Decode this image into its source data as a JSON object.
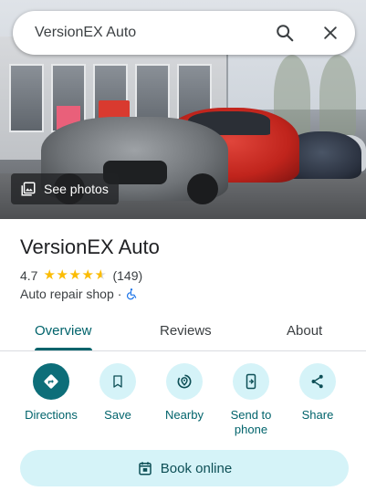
{
  "search": {
    "value": "VersionEX Auto",
    "search_icon": "search-icon",
    "close_icon": "close-icon"
  },
  "hero": {
    "see_photos_label": "See photos",
    "photos_icon": "photo-library-icon"
  },
  "place": {
    "name": "VersionEX Auto",
    "rating": "4.7",
    "stars": 4.7,
    "review_count": "(149)",
    "category": "Auto repair shop",
    "separator": "·",
    "accessibility_icon": "wheelchair-icon"
  },
  "tabs": [
    {
      "label": "Overview",
      "selected": true
    },
    {
      "label": "Reviews",
      "selected": false
    },
    {
      "label": "About",
      "selected": false
    }
  ],
  "actions": [
    {
      "label": "Directions",
      "icon": "directions-icon"
    },
    {
      "label": "Save",
      "icon": "bookmark-icon"
    },
    {
      "label": "Nearby",
      "icon": "nearby-icon"
    },
    {
      "label": "Send to phone",
      "icon": "send-to-phone-icon"
    },
    {
      "label": "Share",
      "icon": "share-icon"
    }
  ],
  "book": {
    "label": "Book online",
    "icon": "calendar-icon"
  },
  "colors": {
    "accent": "#00636b",
    "primary_fill": "#0d6e79",
    "chip_fill": "#d5f3f8",
    "star": "#fbbc04"
  }
}
